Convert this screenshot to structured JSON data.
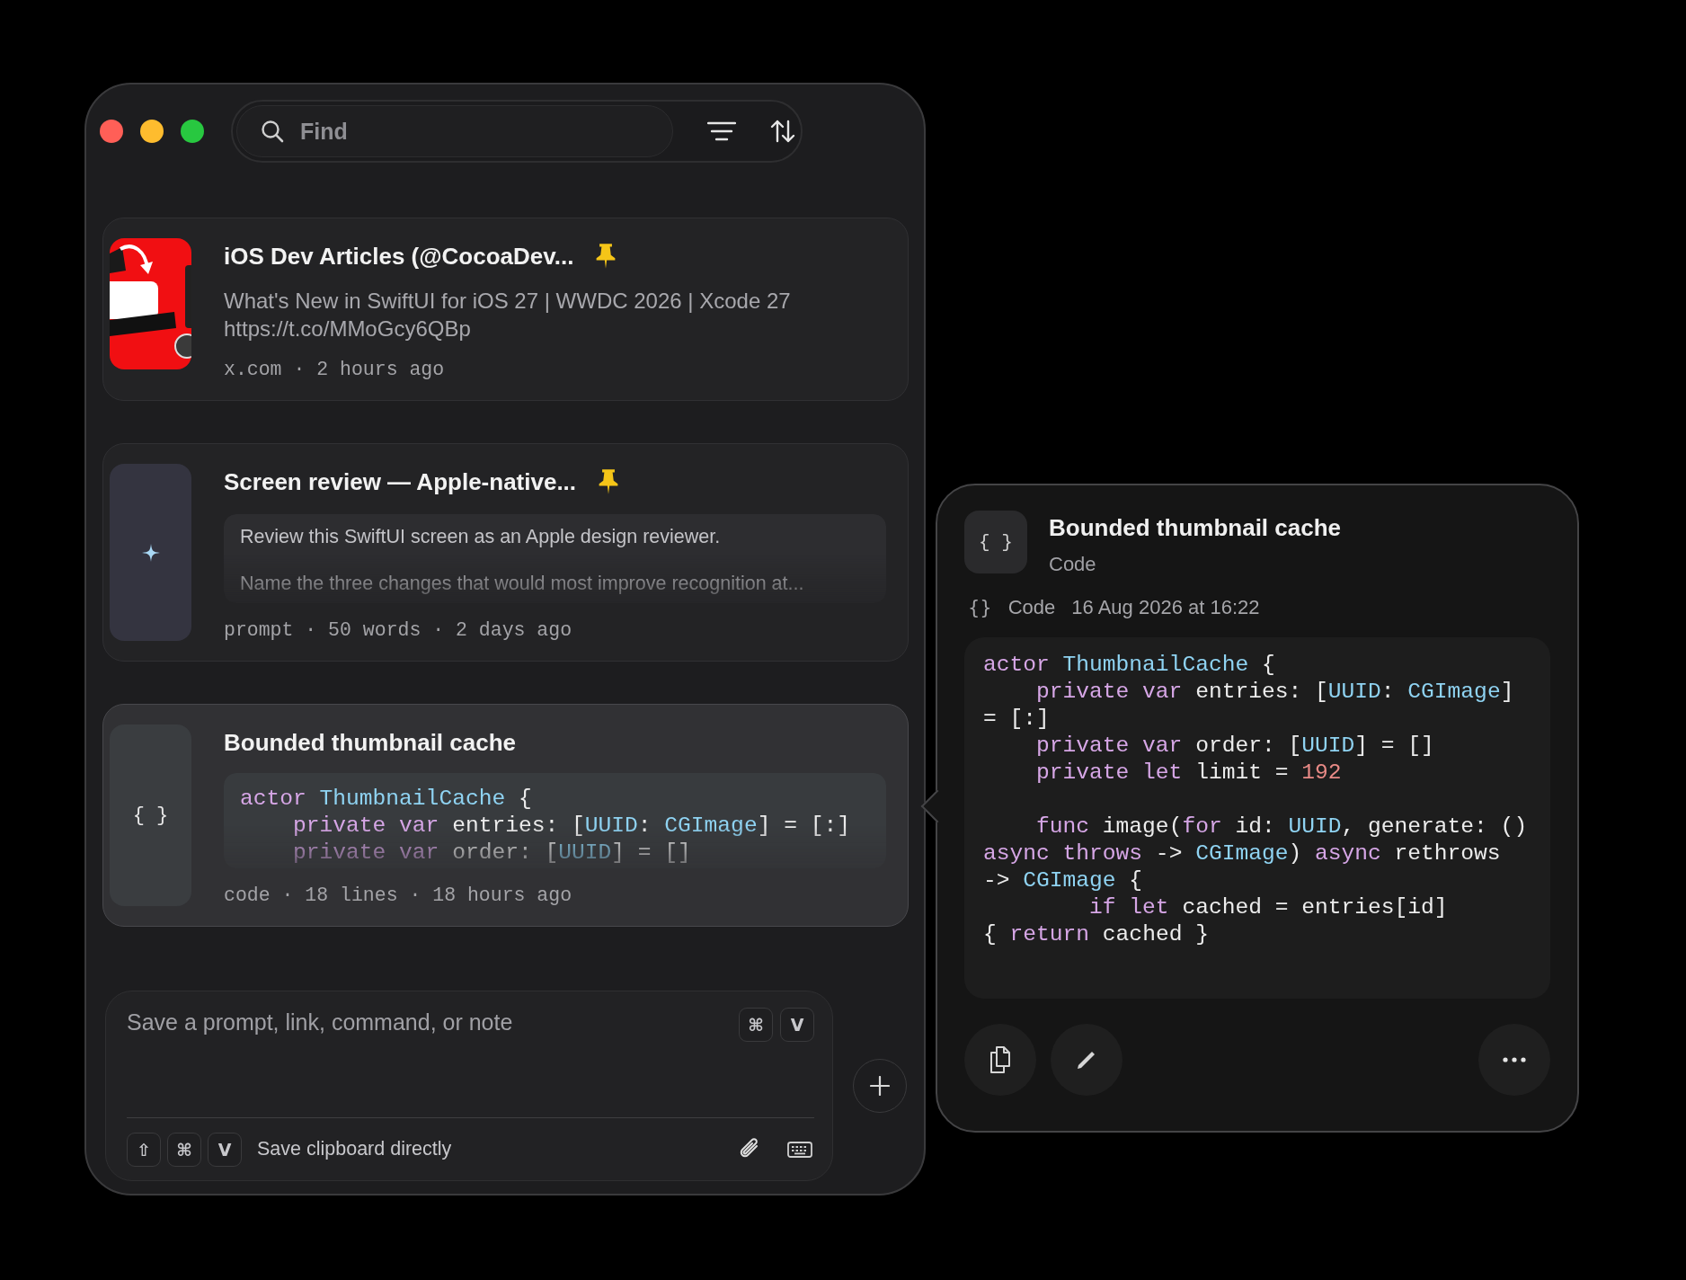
{
  "search": {
    "placeholder": "Find"
  },
  "toolbar": [
    {
      "kind": "filter"
    },
    {
      "kind": "sort"
    }
  ],
  "items": [
    {
      "kind": "link",
      "title": "iOS Dev Articles (@CocoaDev...",
      "pinned": true,
      "selected": false,
      "thumbnail": {
        "kind": "picture"
      },
      "body": [
        "What's New in SwiftUI for iOS 27 | WWDC 2026 | Xcode 27",
        "https://t.co/MMoGcy6QBp"
      ],
      "meta": "x.com · 2 hours ago"
    },
    {
      "kind": "prompt",
      "title": "Screen review — Apple-native...",
      "pinned": true,
      "selected": false,
      "thumbnail": {
        "kind": "sparkle"
      },
      "preview": [
        "Review this SwiftUI screen as an Apple design reviewer.",
        "Name the three changes that would most improve recognition at..."
      ],
      "meta": "prompt · 50 words · 2 days ago"
    },
    {
      "kind": "code",
      "title": "Bounded thumbnail cache",
      "pinned": false,
      "selected": true,
      "thumbnail": {
        "kind": "braces",
        "text": "{ }"
      },
      "code": [
        {
          "segs": [
            {
              "text": "actor",
              "kind": "keyword"
            },
            {
              "text": " ThumbnailCache",
              "kind": "type"
            },
            {
              "text": " {",
              "kind": "plain"
            }
          ]
        },
        {
          "segs": [
            {
              "text": "    private var",
              "kind": "keyword"
            },
            {
              "text": " entries: [",
              "kind": "plain"
            },
            {
              "text": "UUID",
              "kind": "type"
            },
            {
              "text": ": ",
              "kind": "plain"
            },
            {
              "text": "CGImage",
              "kind": "type"
            },
            {
              "text": "] = [:]",
              "kind": "plain"
            }
          ]
        },
        {
          "segs": [
            {
              "text": "    private var",
              "kind": "keyword"
            },
            {
              "text": " order: [",
              "kind": "plain"
            },
            {
              "text": "UUID",
              "kind": "type"
            },
            {
              "text": "] = []",
              "kind": "plain"
            }
          ]
        }
      ],
      "meta": "code · 18 lines · 18 hours ago"
    }
  ],
  "composer": {
    "placeholder": "Save a prompt, link, command, or note",
    "shortcut": [
      "⌘",
      "V"
    ],
    "footer_keys": [
      "⇧",
      "⌘",
      "V"
    ],
    "footer_label": "Save clipboard directly",
    "tools": [
      {
        "kind": "attach"
      },
      {
        "kind": "keyboard"
      }
    ]
  },
  "detail": {
    "icon_text": "{ }",
    "title": "Bounded thumbnail cache",
    "subtitle": "Code",
    "meta_icon": "{}",
    "meta_kind": "Code",
    "meta_date": "16 Aug 2026 at 16:22",
    "code": [
      {
        "segs": [
          {
            "text": "actor",
            "kind": "keyword"
          },
          {
            "text": " ThumbnailCache",
            "kind": "type"
          },
          {
            "text": " {",
            "kind": "plain"
          }
        ]
      },
      {
        "segs": [
          {
            "text": "    private var",
            "kind": "keyword"
          },
          {
            "text": " entries: [",
            "kind": "plain"
          },
          {
            "text": "UUID",
            "kind": "type"
          },
          {
            "text": ": ",
            "kind": "plain"
          },
          {
            "text": "CGImage",
            "kind": "type"
          },
          {
            "text": "]",
            "kind": "plain"
          }
        ]
      },
      {
        "segs": [
          {
            "text": "= [:]",
            "kind": "plain"
          }
        ]
      },
      {
        "segs": [
          {
            "text": "    private var",
            "kind": "keyword"
          },
          {
            "text": " order: [",
            "kind": "plain"
          },
          {
            "text": "UUID",
            "kind": "type"
          },
          {
            "text": "] = []",
            "kind": "plain"
          }
        ]
      },
      {
        "segs": [
          {
            "text": "    private let",
            "kind": "keyword"
          },
          {
            "text": " limit = ",
            "kind": "plain"
          },
          {
            "text": "192",
            "kind": "number"
          }
        ]
      },
      {
        "gap_before": true,
        "segs": [
          {
            "text": "    func",
            "kind": "keyword"
          },
          {
            "text": " image(",
            "kind": "plain"
          },
          {
            "text": "for",
            "kind": "keyword"
          },
          {
            "text": " id: ",
            "kind": "plain"
          },
          {
            "text": "UUID",
            "kind": "type"
          },
          {
            "text": ", generate: ()",
            "kind": "plain"
          }
        ]
      },
      {
        "segs": [
          {
            "text": "async throws",
            "kind": "keyword"
          },
          {
            "text": " -> ",
            "kind": "plain"
          },
          {
            "text": "CGImage",
            "kind": "type"
          },
          {
            "text": ") ",
            "kind": "plain"
          },
          {
            "text": "async",
            "kind": "keyword"
          },
          {
            "text": " rethrows",
            "kind": "plain"
          }
        ]
      },
      {
        "segs": [
          {
            "text": "-> ",
            "kind": "plain"
          },
          {
            "text": "CGImage",
            "kind": "type"
          },
          {
            "text": " {",
            "kind": "plain"
          }
        ]
      },
      {
        "segs": [
          {
            "text": "        if let",
            "kind": "keyword"
          },
          {
            "text": " cached = entries[id]",
            "kind": "plain"
          }
        ]
      },
      {
        "segs": [
          {
            "text": "{ ",
            "kind": "plain"
          },
          {
            "text": "return",
            "kind": "keyword"
          },
          {
            "text": " cached }",
            "kind": "plain"
          }
        ]
      }
    ],
    "actions": [
      {
        "kind": "copy"
      },
      {
        "kind": "edit"
      },
      {
        "kind": "more"
      }
    ]
  }
}
